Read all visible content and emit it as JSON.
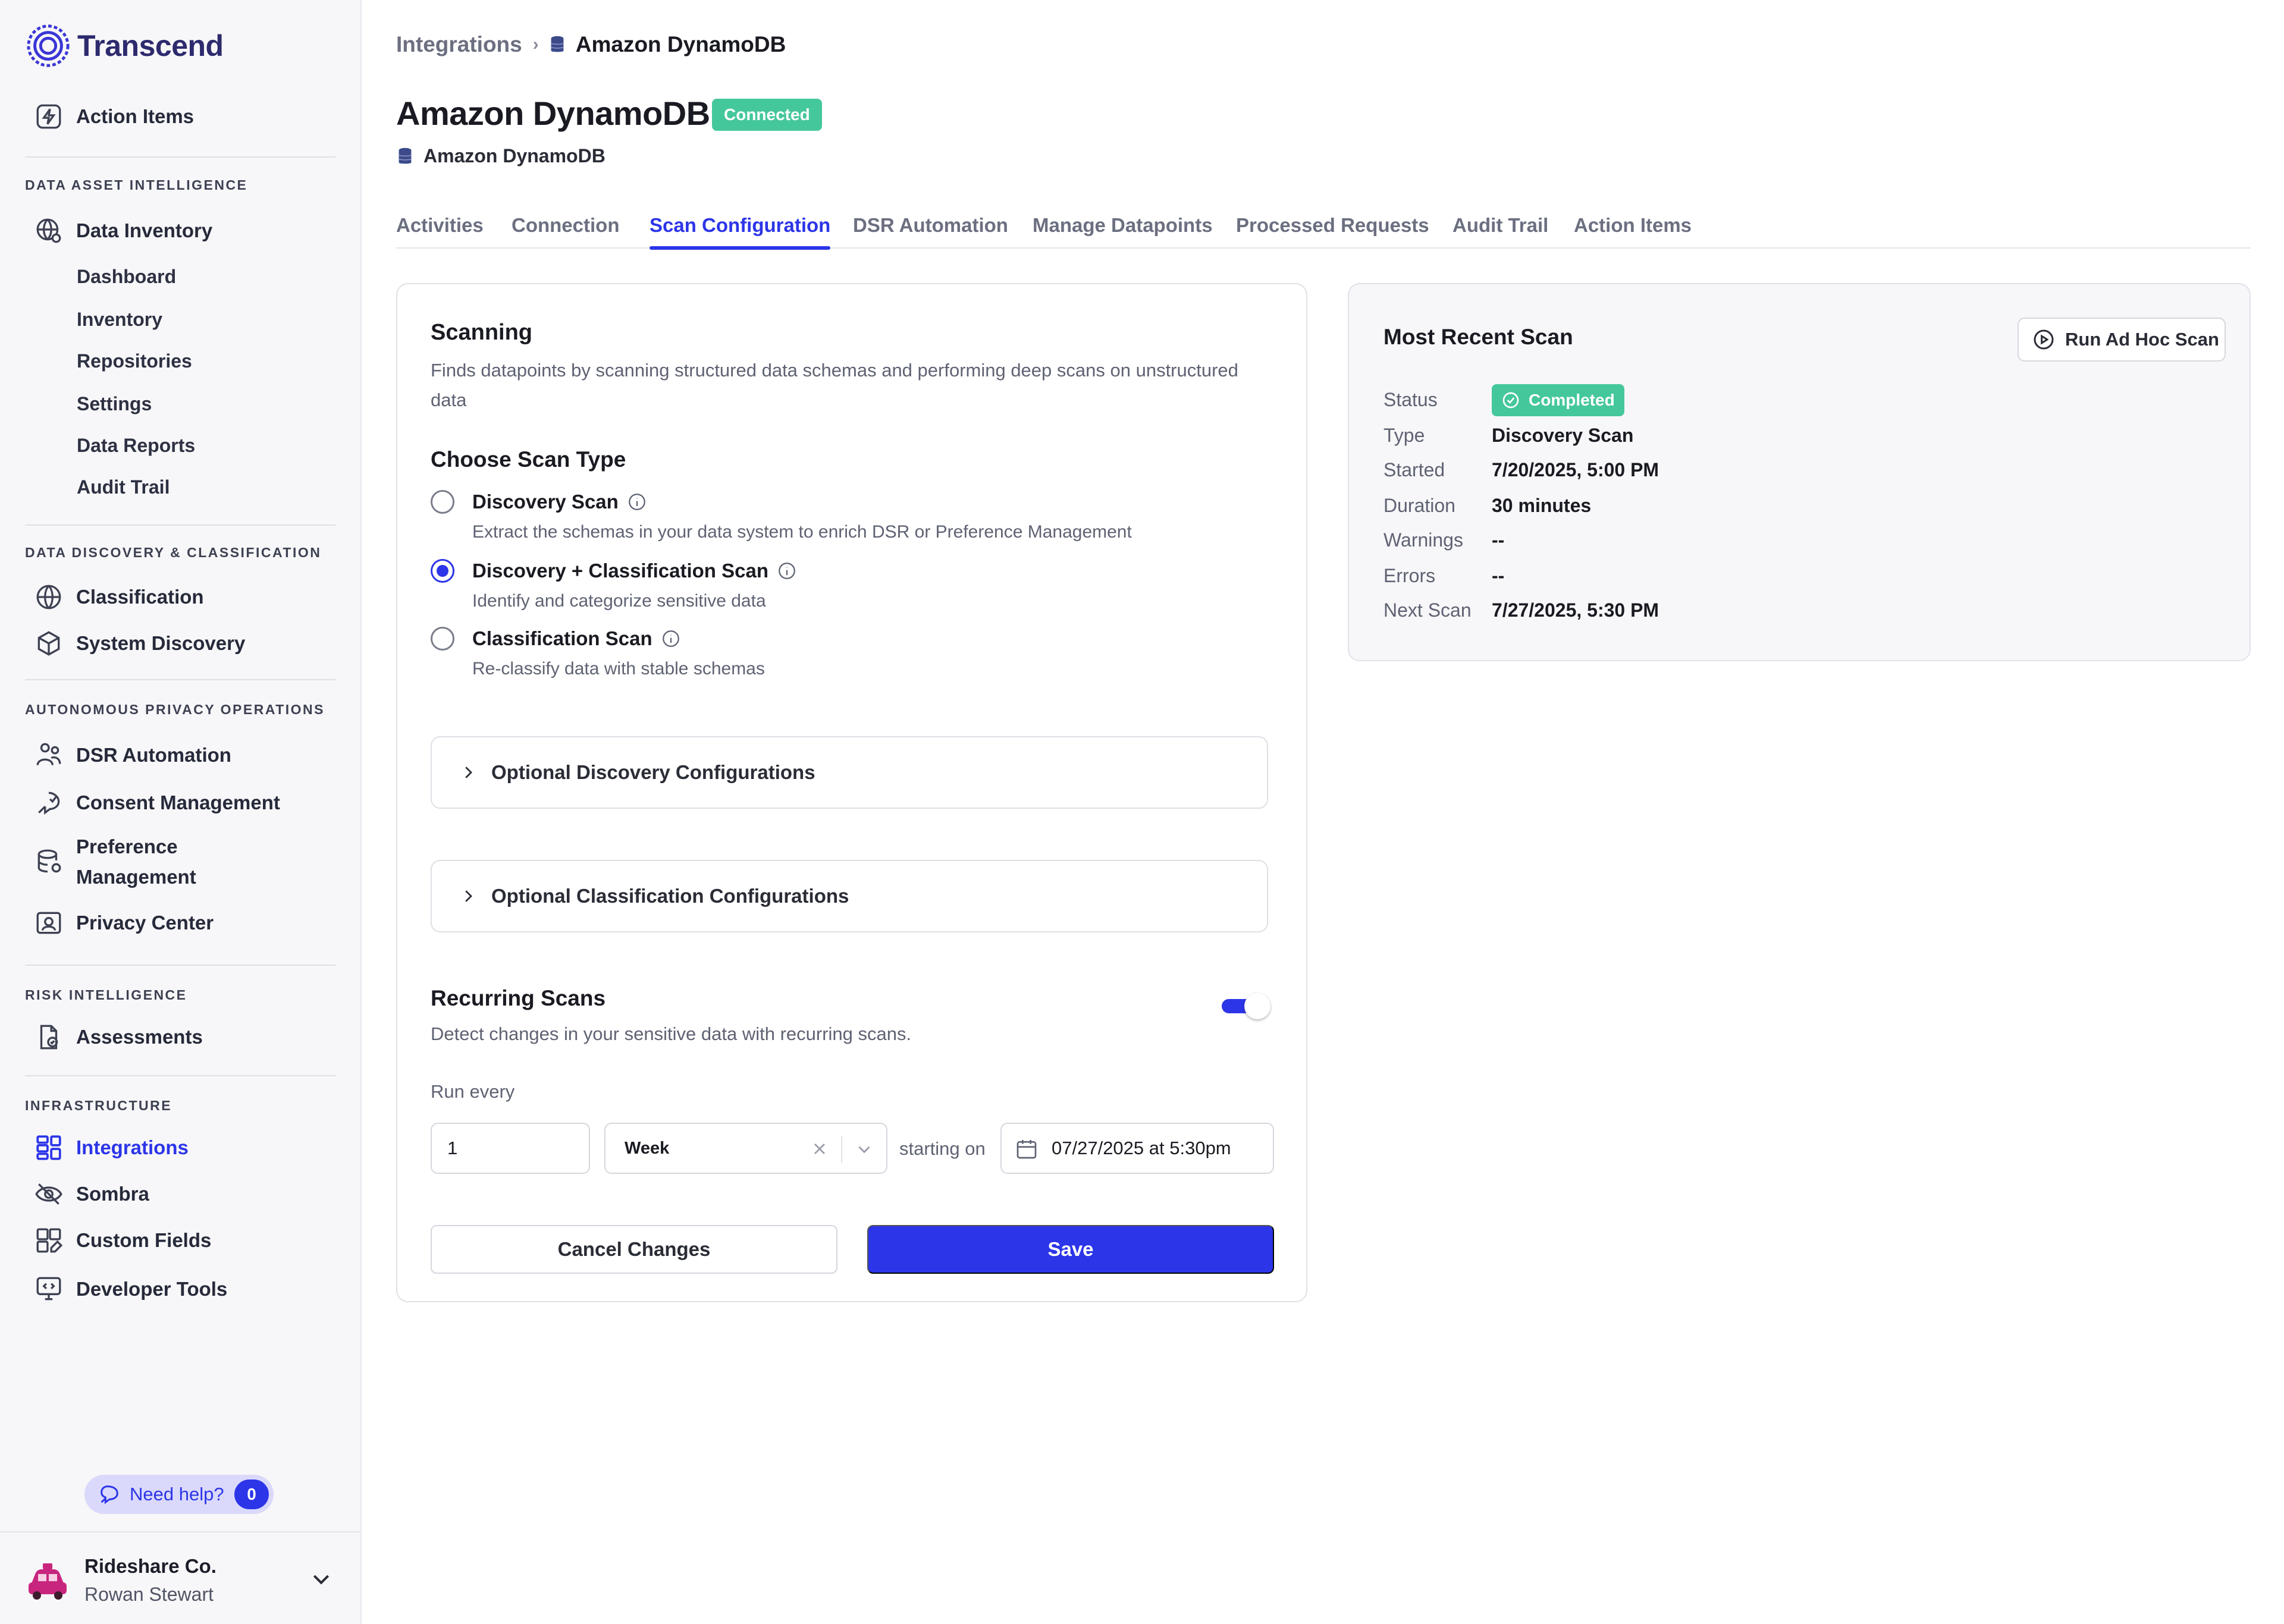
{
  "app": {
    "name": "Transcend"
  },
  "sidebar": {
    "action_items": "Action Items",
    "sections": {
      "data_asset_intelligence": "DATA ASSET INTELLIGENCE",
      "data_discovery": "DATA DISCOVERY & CLASSIFICATION",
      "privacy_ops": "AUTONOMOUS PRIVACY OPERATIONS",
      "risk": "RISK INTELLIGENCE",
      "infrastructure": "INFRASTRUCTURE"
    },
    "data_inventory": "Data Inventory",
    "data_inventory_sub": [
      "Dashboard",
      "Inventory",
      "Repositories",
      "Settings",
      "Data Reports",
      "Audit Trail"
    ],
    "classification": "Classification",
    "system_discovery": "System Discovery",
    "dsr_automation": "DSR Automation",
    "consent_management": "Consent Management",
    "preference_management_1": "Preference",
    "preference_management_2": "Management",
    "privacy_center": "Privacy Center",
    "assessments": "Assessments",
    "integrations": "Integrations",
    "sombra": "Sombra",
    "custom_fields": "Custom Fields",
    "developer_tools": "Developer Tools",
    "help": {
      "label": "Need help?",
      "count": "0"
    },
    "account": {
      "org": "Rideshare Co.",
      "user": "Rowan Stewart"
    }
  },
  "breadcrumb": {
    "parent": "Integrations",
    "current": "Amazon DynamoDB"
  },
  "page": {
    "title": "Amazon DynamoDB",
    "status_badge": "Connected",
    "subtitle": "Amazon DynamoDB"
  },
  "tabs": [
    "Activities",
    "Connection",
    "Scan Configuration",
    "DSR Automation",
    "Manage Datapoints",
    "Processed Requests",
    "Audit Trail",
    "Action Items"
  ],
  "scanning": {
    "title": "Scanning",
    "description_1": "Finds datapoints by scanning structured data schemas and performing deep scans on unstructured",
    "description_2": "data",
    "choose_title": "Choose Scan Type",
    "options": [
      {
        "label": "Discovery Scan",
        "desc": "Extract the schemas in your data system to enrich DSR or Preference Management"
      },
      {
        "label": "Discovery + Classification Scan",
        "desc": "Identify and categorize sensitive data"
      },
      {
        "label": "Classification Scan",
        "desc": "Re-classify data with stable schemas"
      }
    ],
    "accordion_discovery": "Optional Discovery Configurations",
    "accordion_classification": "Optional Classification Configurations",
    "recurring_title": "Recurring Scans",
    "recurring_desc": "Detect changes in your sensitive data with recurring scans.",
    "recurring_enabled": true,
    "run_every_label": "Run every",
    "run_every_value": "1",
    "period_value": "Week",
    "starting_on_label": "starting on",
    "start_date_value": "07/27/2025 at 5:30pm",
    "cancel_label": "Cancel Changes",
    "save_label": "Save"
  },
  "recent_scan": {
    "title": "Most Recent Scan",
    "run_button": "Run Ad Hoc Scan",
    "status_key": "Status",
    "status_value": "Completed",
    "type_key": "Type",
    "type_value": "Discovery Scan",
    "started_key": "Started",
    "started_value": "7/20/2025, 5:00 PM",
    "duration_key": "Duration",
    "duration_value": "30 minutes",
    "warnings_key": "Warnings",
    "warnings_value": "--",
    "errors_key": "Errors",
    "errors_value": "--",
    "next_key": "Next Scan",
    "next_value": "7/27/2025, 5:30 PM"
  },
  "colors": {
    "accent": "#2c35e8",
    "success": "#45c79c",
    "brand": "#2d2a6e"
  }
}
